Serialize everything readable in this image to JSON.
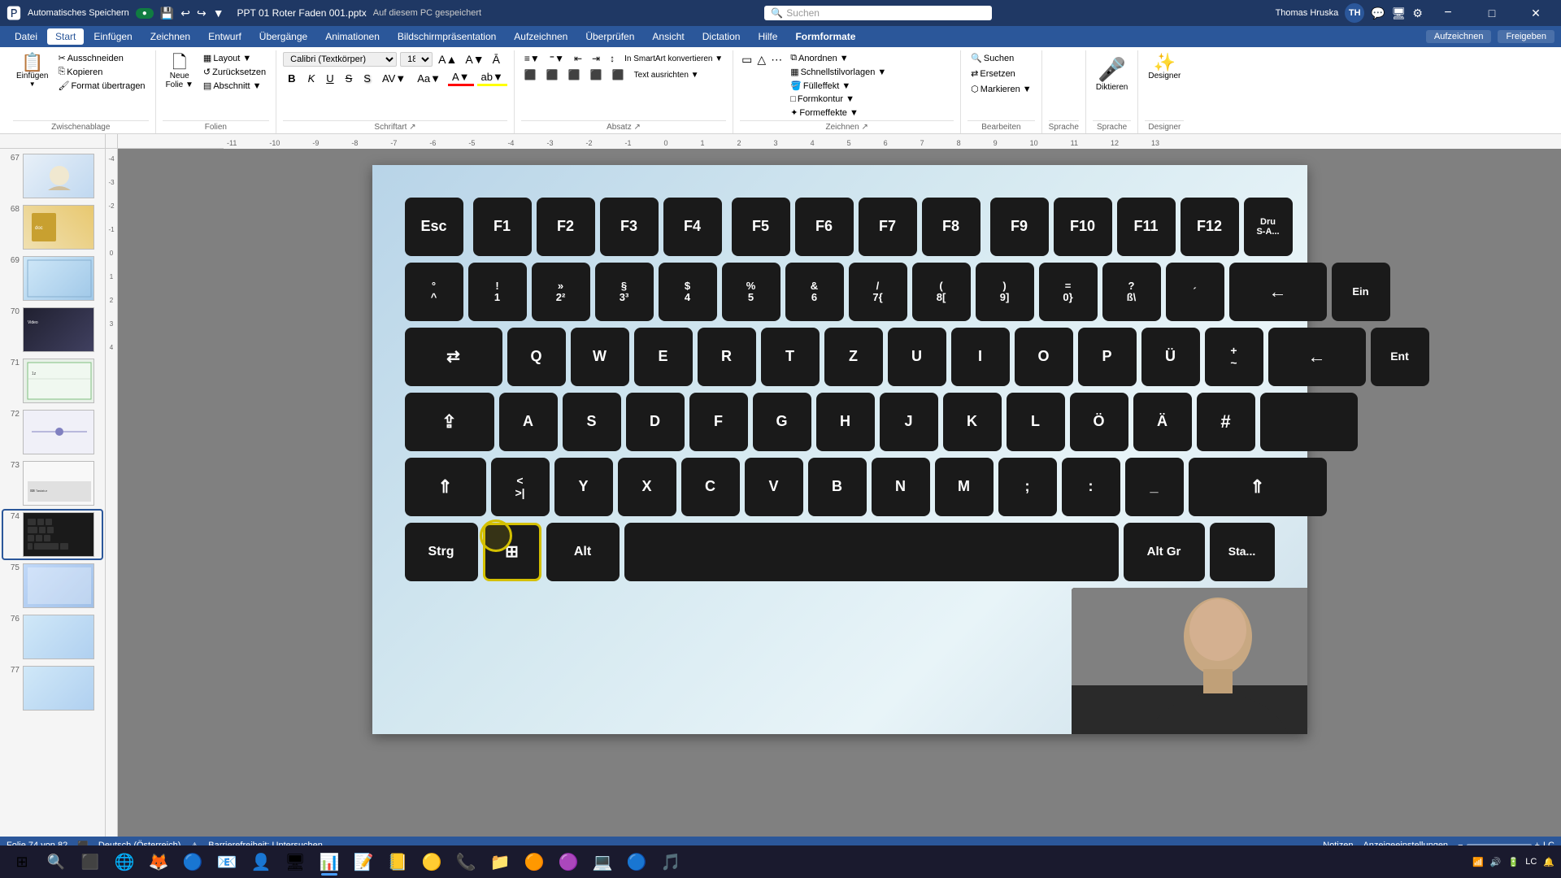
{
  "titlebar": {
    "autosave_label": "Automatisches Speichern",
    "filename": "PPT 01 Roter Faden 001.pptx",
    "save_location": "Auf diesem PC gespeichert",
    "search_placeholder": "Suchen",
    "user_name": "Thomas Hruska",
    "minimize_label": "−",
    "maximize_label": "□",
    "close_label": "✕"
  },
  "menu": {
    "items": [
      {
        "label": "Datei",
        "active": false
      },
      {
        "label": "Start",
        "active": true
      },
      {
        "label": "Einfügen",
        "active": false
      },
      {
        "label": "Zeichnen",
        "active": false
      },
      {
        "label": "Entwurf",
        "active": false
      },
      {
        "label": "Übergänge",
        "active": false
      },
      {
        "label": "Animationen",
        "active": false
      },
      {
        "label": "Bildschirmpräsentation",
        "active": false
      },
      {
        "label": "Aufzeichnen",
        "active": false
      },
      {
        "label": "Überprüfen",
        "active": false
      },
      {
        "label": "Ansicht",
        "active": false
      },
      {
        "label": "Dictation",
        "active": false
      },
      {
        "label": "Hilfe",
        "active": false
      },
      {
        "label": "Formformate",
        "active": false
      }
    ]
  },
  "ribbon": {
    "groups": [
      {
        "name": "clipboard",
        "label": "Zwischenablage",
        "buttons": [
          "Einfügen",
          "Ausschneiden",
          "Kopieren",
          "Format übertragen"
        ]
      },
      {
        "name": "slides",
        "label": "Folien",
        "buttons": [
          "Neue Folie",
          "Layout",
          "Zurücksetzen",
          "Abschnitt"
        ]
      },
      {
        "name": "font",
        "label": "Schriftart",
        "font_name": "Calibri (Textkörper)",
        "font_size": "18"
      },
      {
        "name": "paragraph",
        "label": "Absatz"
      },
      {
        "name": "drawing",
        "label": "Zeichnen"
      },
      {
        "name": "editing",
        "label": "Bearbeiten",
        "buttons": [
          "Suchen",
          "Ersetzen",
          "Markieren"
        ]
      },
      {
        "name": "language",
        "label": "Sprache"
      },
      {
        "name": "dictation",
        "label": "Diktieren",
        "button": "Diktieren"
      },
      {
        "name": "designer",
        "label": "Designer",
        "button": "Designer"
      }
    ],
    "record_btn": "Aufzeichnen",
    "share_btn": "Freigeben"
  },
  "slide_panel": {
    "slides": [
      {
        "num": 67,
        "active": false
      },
      {
        "num": 68,
        "active": false
      },
      {
        "num": 69,
        "active": false
      },
      {
        "num": 70,
        "active": false
      },
      {
        "num": 71,
        "active": false
      },
      {
        "num": 72,
        "active": false
      },
      {
        "num": 73,
        "active": false
      },
      {
        "num": 74,
        "active": true
      },
      {
        "num": 75,
        "active": false
      },
      {
        "num": 76,
        "active": false
      },
      {
        "num": 77,
        "active": false
      }
    ]
  },
  "keyboard": {
    "rows": [
      {
        "keys": [
          {
            "label": "Esc",
            "wide": false
          },
          {
            "label": "F1"
          },
          {
            "label": "F2"
          },
          {
            "label": "F3"
          },
          {
            "label": "F4"
          },
          {
            "label": "F5"
          },
          {
            "label": "F6"
          },
          {
            "label": "F7"
          },
          {
            "label": "F8"
          },
          {
            "label": "F9"
          },
          {
            "label": "F10"
          },
          {
            "label": "F11"
          },
          {
            "label": "F12"
          },
          {
            "label": "Dru\nS-A...",
            "small": true
          }
        ]
      },
      {
        "keys": [
          {
            "label": "°\n^"
          },
          {
            "label": "!\n1"
          },
          {
            "label": "»\n2²"
          },
          {
            "label": "§\n3³"
          },
          {
            "label": "$\n4"
          },
          {
            "label": "%\n5"
          },
          {
            "label": "&\n6"
          },
          {
            "label": "/\n7{"
          },
          {
            "label": "(\n8["
          },
          {
            "label": ")\n9]"
          },
          {
            "label": "=\n0}"
          },
          {
            "label": "?\nß\\"
          },
          {
            "label": "´\n`"
          },
          {
            "label": "←",
            "wide": true
          },
          {
            "label": "Ein",
            "wide": false
          }
        ]
      },
      {
        "keys": [
          {
            "label": "⇄",
            "wide": true
          },
          {
            "label": "Q"
          },
          {
            "label": "W"
          },
          {
            "label": "E"
          },
          {
            "label": "R"
          },
          {
            "label": "T"
          },
          {
            "label": "Z"
          },
          {
            "label": "U"
          },
          {
            "label": "I"
          },
          {
            "label": "O"
          },
          {
            "label": "P"
          },
          {
            "label": "Ü"
          },
          {
            "label": "+\n~"
          },
          {
            "label": "←",
            "wide": true
          },
          {
            "label": "Ent"
          }
        ]
      },
      {
        "keys": [
          {
            "label": "⇪",
            "wide": true
          },
          {
            "label": "A"
          },
          {
            "label": "S"
          },
          {
            "label": "D"
          },
          {
            "label": "F"
          },
          {
            "label": "G"
          },
          {
            "label": "H"
          },
          {
            "label": "J"
          },
          {
            "label": "K"
          },
          {
            "label": "L"
          },
          {
            "label": "Ö"
          },
          {
            "label": "Ä"
          },
          {
            "label": "#"
          },
          {
            "label": "",
            "wide": true
          }
        ]
      },
      {
        "keys": [
          {
            "label": "⇑",
            "wide": true
          },
          {
            "label": "<\n>|"
          },
          {
            "label": "Y"
          },
          {
            "label": "X"
          },
          {
            "label": "C"
          },
          {
            "label": "V"
          },
          {
            "label": "B"
          },
          {
            "label": "N"
          },
          {
            "label": "M"
          },
          {
            "label": ";"
          },
          {
            "label": ":"
          },
          {
            "label": "_"
          },
          {
            "label": "⇑",
            "wide": true
          }
        ]
      },
      {
        "keys": [
          {
            "label": "Strg"
          },
          {
            "label": "⊞"
          },
          {
            "label": "Alt"
          },
          {
            "label": "",
            "space": true
          },
          {
            "label": "Alt Gr"
          },
          {
            "label": "Sta..."
          }
        ]
      }
    ]
  },
  "statusbar": {
    "slide_info": "Folie 74 von 82",
    "language": "Deutsch (Österreich)",
    "accessibility": "Barrierefreiheit: Untersuchen",
    "notes": "Notizen",
    "settings": "Anzeigeeinstellungen"
  },
  "taskbar": {
    "time": "LC",
    "apps": [
      "⊞",
      "🔍",
      "📁",
      "🌐",
      "🦊",
      "🔵",
      "📧",
      "👤",
      "🖥",
      "📝",
      "🔵",
      "📌",
      "🎵",
      "📞",
      "💾",
      "🟡",
      "🔵",
      "🟠",
      "🟣",
      "🟤"
    ]
  }
}
